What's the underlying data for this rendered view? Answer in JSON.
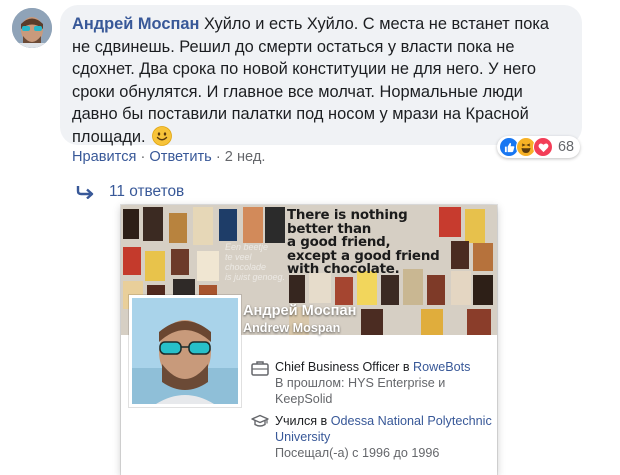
{
  "comment": {
    "author": "Андрей Моспан",
    "text": "Хуйло и есть Хуйло. С места не встанет пока не сдвинешь. Решил до смерти остаться у власти пока не сдохнет. Два срока по новой конституции не для него. У него сроки обнулятся. И главное все молчат. Нормальные люди давно бы поставили палатки под носом у мрази на Красной площади."
  },
  "actions": {
    "like": "Нравится",
    "reply": "Ответить",
    "time": "2 нед.",
    "separator": "·"
  },
  "reactions": {
    "icons": [
      "like-icon",
      "haha-icon",
      "love-icon"
    ],
    "count": "68",
    "colors": {
      "like": "#1877f2",
      "haha": "#f7b125",
      "love": "#f33e58"
    }
  },
  "replies": {
    "label": "11 ответов"
  },
  "hover_card": {
    "cover_text": "There is nothing\nbetter than\na good friend,\nexcept a good friend\nwith chocolate.",
    "cover_small_text": "Een beetje\nte veel\nchocolade\nis juist genoeg.",
    "name": "Андрей Моспан",
    "name_latin": "Andrew Mospan",
    "work": {
      "prefix": "Chief Business Officer в ",
      "company": "RoweBots",
      "past": "В прошлом: HYS Enterprise и KeepSolid"
    },
    "education": {
      "prefix": "Учился в ",
      "school": "Odessa National Polytechnic University",
      "dates": "Посещал(-а) с 1996 до 1996"
    }
  },
  "colors": {
    "link": "#385898",
    "bubble": "#f0f2f5",
    "meta": "#65676b"
  }
}
